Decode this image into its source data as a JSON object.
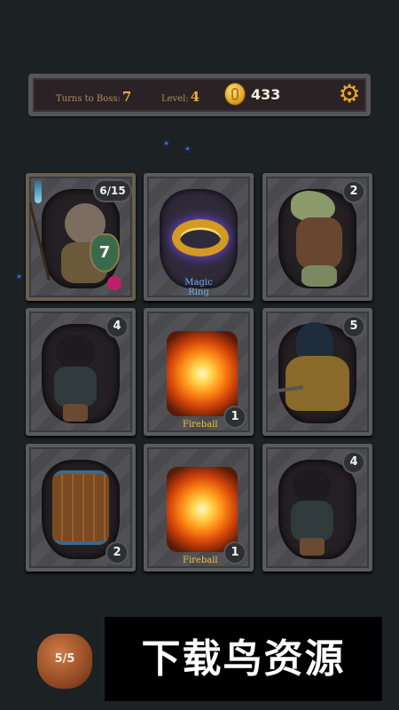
{
  "hud": {
    "turns_label": "Turns to Boss:",
    "turns_value": "7",
    "level_label": "Level:",
    "level_value": "4",
    "gold": "433",
    "settings_icon": "gear-icon",
    "coin_icon": "coin-icon"
  },
  "player": {
    "hp": "6/15",
    "shield": "7",
    "potion_icon": "potion-icon",
    "staff_icon": "staff-icon"
  },
  "cards": [
    {
      "name": "player",
      "type": "hero"
    },
    {
      "name": "Magic Ring",
      "type": "item",
      "label_line1": "Magic",
      "label_line2": "Ring"
    },
    {
      "name": "lizard-warrior",
      "type": "enemy",
      "value": "2"
    },
    {
      "name": "cat-archer",
      "type": "enemy",
      "value": "4"
    },
    {
      "name": "Fireball",
      "type": "spell",
      "label": "Fireball",
      "value": "1"
    },
    {
      "name": "hooded-rogue",
      "type": "enemy",
      "value": "5"
    },
    {
      "name": "barrel",
      "type": "object",
      "value": "2"
    },
    {
      "name": "Fireball",
      "type": "spell",
      "label": "Fireball",
      "value": "1"
    },
    {
      "name": "cat-archer",
      "type": "enemy",
      "value": "4"
    }
  ],
  "inventory": {
    "bag": "5/5"
  },
  "watermark": "下载鸟资源",
  "colors": {
    "accent": "#f0a84a",
    "ring_label": "#6fb0e8",
    "spell_label": "#f0c040"
  }
}
